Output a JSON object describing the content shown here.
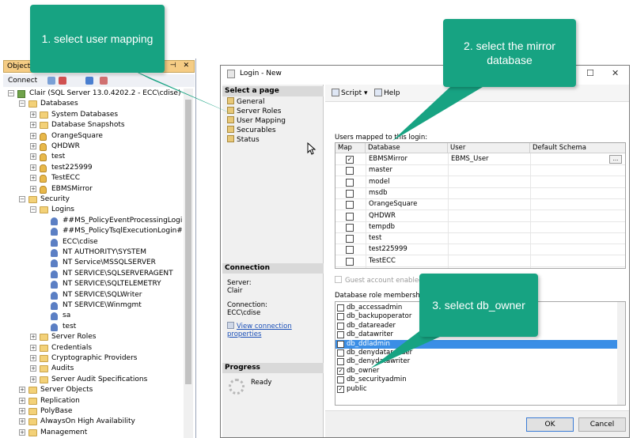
{
  "object_explorer": {
    "title": "Object E",
    "toolbar_label": "Connect",
    "tree": [
      {
        "label": "Clair (SQL Server 13.0.4202.2 - ECC\\cdise)",
        "indent": 0,
        "icon": "server-icon",
        "exp": "−"
      },
      {
        "label": "Databases",
        "indent": 1,
        "icon": "folder-icon",
        "exp": "−"
      },
      {
        "label": "System Databases",
        "indent": 2,
        "icon": "folder-icon",
        "exp": "+"
      },
      {
        "label": "Database Snapshots",
        "indent": 2,
        "icon": "folder-icon",
        "exp": "+"
      },
      {
        "label": "OrangeSquare",
        "indent": 2,
        "icon": "database-icon",
        "exp": "+"
      },
      {
        "label": "QHDWR",
        "indent": 2,
        "icon": "database-icon",
        "exp": "+"
      },
      {
        "label": "test",
        "indent": 2,
        "icon": "database-icon",
        "exp": "+"
      },
      {
        "label": "test225999",
        "indent": 2,
        "icon": "database-icon",
        "exp": "+"
      },
      {
        "label": "TestECC",
        "indent": 2,
        "icon": "database-icon",
        "exp": "+"
      },
      {
        "label": "EBMSMirror",
        "indent": 2,
        "icon": "database-icon",
        "exp": "+"
      },
      {
        "label": "Security",
        "indent": 1,
        "icon": "folder-icon",
        "exp": "−"
      },
      {
        "label": "Logins",
        "indent": 2,
        "icon": "folder-icon",
        "exp": "−"
      },
      {
        "label": "##MS_PolicyEventProcessingLogin##",
        "indent": 3,
        "icon": "login-user-icon",
        "exp": ""
      },
      {
        "label": "##MS_PolicyTsqlExecutionLogin##",
        "indent": 3,
        "icon": "login-user-icon",
        "exp": ""
      },
      {
        "label": "ECC\\cdise",
        "indent": 3,
        "icon": "login-user-icon",
        "exp": ""
      },
      {
        "label": "NT AUTHORITY\\SYSTEM",
        "indent": 3,
        "icon": "login-user-icon",
        "exp": ""
      },
      {
        "label": "NT Service\\MSSQLSERVER",
        "indent": 3,
        "icon": "login-user-icon",
        "exp": ""
      },
      {
        "label": "NT SERVICE\\SQLSERVERAGENT",
        "indent": 3,
        "icon": "login-user-icon",
        "exp": ""
      },
      {
        "label": "NT SERVICE\\SQLTELEMETRY",
        "indent": 3,
        "icon": "login-user-icon",
        "exp": ""
      },
      {
        "label": "NT SERVICE\\SQLWriter",
        "indent": 3,
        "icon": "login-user-icon",
        "exp": ""
      },
      {
        "label": "NT SERVICE\\Winmgmt",
        "indent": 3,
        "icon": "login-user-icon",
        "exp": ""
      },
      {
        "label": "sa",
        "indent": 3,
        "icon": "login-user-icon",
        "exp": ""
      },
      {
        "label": "test",
        "indent": 3,
        "icon": "login-user-icon",
        "exp": ""
      },
      {
        "label": "Server Roles",
        "indent": 2,
        "icon": "folder-icon",
        "exp": "+"
      },
      {
        "label": "Credentials",
        "indent": 2,
        "icon": "folder-icon",
        "exp": "+"
      },
      {
        "label": "Cryptographic Providers",
        "indent": 2,
        "icon": "folder-icon",
        "exp": "+"
      },
      {
        "label": "Audits",
        "indent": 2,
        "icon": "folder-icon",
        "exp": "+"
      },
      {
        "label": "Server Audit Specifications",
        "indent": 2,
        "icon": "folder-icon",
        "exp": "+"
      },
      {
        "label": "Server Objects",
        "indent": 1,
        "icon": "folder-icon",
        "exp": "+"
      },
      {
        "label": "Replication",
        "indent": 1,
        "icon": "folder-icon",
        "exp": "+"
      },
      {
        "label": "PolyBase",
        "indent": 1,
        "icon": "folder-icon",
        "exp": "+"
      },
      {
        "label": "AlwaysOn High Availability",
        "indent": 1,
        "icon": "folder-icon",
        "exp": "+"
      },
      {
        "label": "Management",
        "indent": 1,
        "icon": "folder-icon",
        "exp": "+"
      }
    ]
  },
  "dialog": {
    "title": "Login - New",
    "select_page_header": "Select a page",
    "pages": [
      "General",
      "Server Roles",
      "User Mapping",
      "Securables",
      "Status"
    ],
    "connection_header": "Connection",
    "server_label": "Server:",
    "server_value": "Clair",
    "connection_label": "Connection:",
    "connection_value": "ECC\\cdise",
    "view_connection_link": "View connection properties",
    "progress_header": "Progress",
    "progress_status": "Ready",
    "toolbar": {
      "script": "Script",
      "help": "Help"
    },
    "users_mapped_label": "Users mapped to this login:",
    "grid_headers": {
      "map": "Map",
      "database": "Database",
      "user": "User",
      "default_schema": "Default Schema"
    },
    "mapped_rows": [
      {
        "checked": true,
        "database": "EBMSMirror",
        "user": "EBMS_User"
      },
      {
        "checked": false,
        "database": "master",
        "user": ""
      },
      {
        "checked": false,
        "database": "model",
        "user": ""
      },
      {
        "checked": false,
        "database": "msdb",
        "user": ""
      },
      {
        "checked": false,
        "database": "OrangeSquare",
        "user": ""
      },
      {
        "checked": false,
        "database": "QHDWR",
        "user": ""
      },
      {
        "checked": false,
        "database": "tempdb",
        "user": ""
      },
      {
        "checked": false,
        "database": "test",
        "user": ""
      },
      {
        "checked": false,
        "database": "test225999",
        "user": ""
      },
      {
        "checked": false,
        "database": "TestECC",
        "user": ""
      }
    ],
    "guest_label": "Guest account enabled for: EBMSMirror",
    "role_membership_label": "Database role membership for: EBMSMirror",
    "roles": [
      {
        "name": "db_accessadmin",
        "checked": false,
        "selected": false
      },
      {
        "name": "db_backupoperator",
        "checked": false,
        "selected": false
      },
      {
        "name": "db_datareader",
        "checked": false,
        "selected": false
      },
      {
        "name": "db_datawriter",
        "checked": false,
        "selected": false
      },
      {
        "name": "db_ddladmin",
        "checked": false,
        "selected": true
      },
      {
        "name": "db_denydatareader",
        "checked": false,
        "selected": false
      },
      {
        "name": "db_denydatawriter",
        "checked": false,
        "selected": false
      },
      {
        "name": "db_owner",
        "checked": true,
        "selected": false
      },
      {
        "name": "db_securityadmin",
        "checked": false,
        "selected": false
      },
      {
        "name": "public",
        "checked": true,
        "selected": false
      }
    ],
    "ok_label": "OK",
    "cancel_label": "Cancel"
  },
  "callouts": {
    "step1": "1. select user mapping",
    "step2": "2. select the mirror database",
    "step3": "3. select db_owner"
  },
  "colors": {
    "callout": "#17a382",
    "selection": "#3a8ee6",
    "oe_title": "#f5cc84"
  }
}
